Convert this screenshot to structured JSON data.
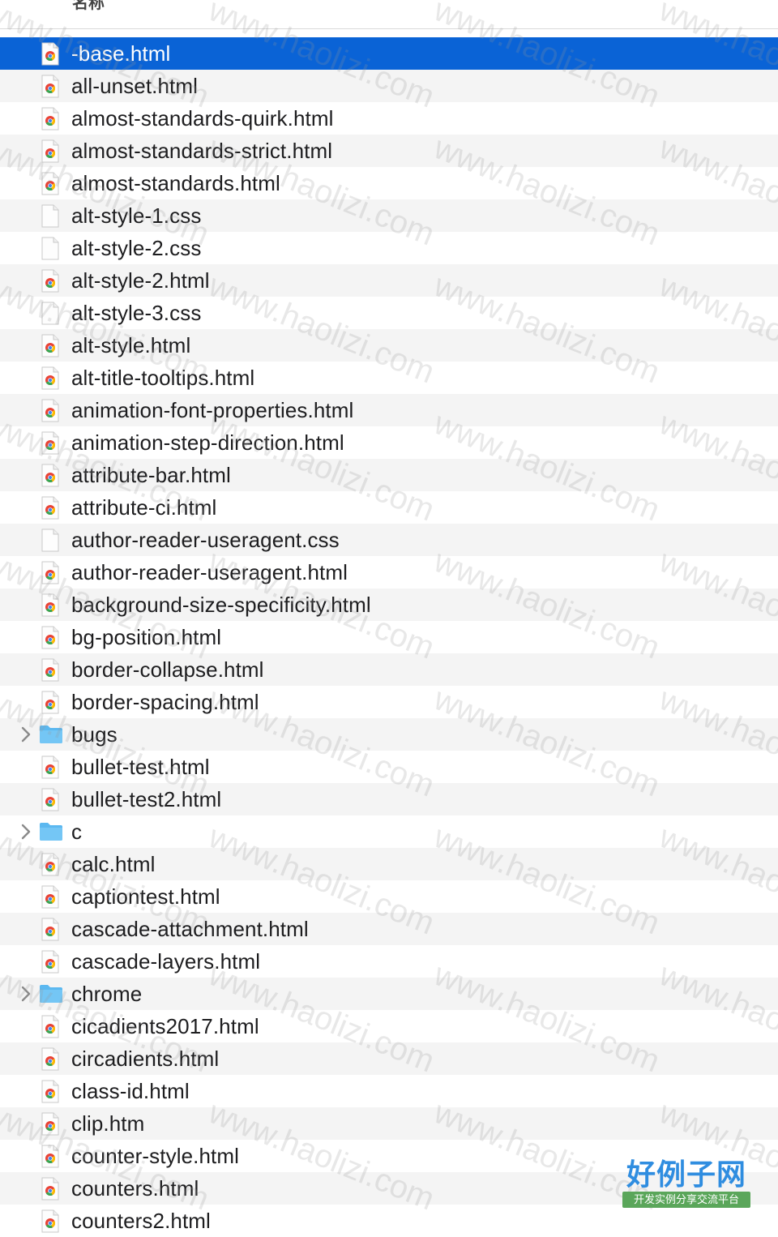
{
  "header": {
    "column_label": "名称"
  },
  "files": [
    {
      "name": "-base.html",
      "type": "html",
      "selected": true
    },
    {
      "name": "all-unset.html",
      "type": "html"
    },
    {
      "name": "almost-standards-quirk.html",
      "type": "html"
    },
    {
      "name": "almost-standards-strict.html",
      "type": "html"
    },
    {
      "name": "almost-standards.html",
      "type": "html"
    },
    {
      "name": "alt-style-1.css",
      "type": "css"
    },
    {
      "name": "alt-style-2.css",
      "type": "css"
    },
    {
      "name": "alt-style-2.html",
      "type": "html"
    },
    {
      "name": "alt-style-3.css",
      "type": "css"
    },
    {
      "name": "alt-style.html",
      "type": "html"
    },
    {
      "name": "alt-title-tooltips.html",
      "type": "html"
    },
    {
      "name": "animation-font-properties.html",
      "type": "html"
    },
    {
      "name": "animation-step-direction.html",
      "type": "html"
    },
    {
      "name": "attribute-bar.html",
      "type": "html"
    },
    {
      "name": "attribute-ci.html",
      "type": "html"
    },
    {
      "name": "author-reader-useragent.css",
      "type": "css"
    },
    {
      "name": "author-reader-useragent.html",
      "type": "html"
    },
    {
      "name": "background-size-specificity.html",
      "type": "html"
    },
    {
      "name": "bg-position.html",
      "type": "html"
    },
    {
      "name": "border-collapse.html",
      "type": "html"
    },
    {
      "name": "border-spacing.html",
      "type": "html"
    },
    {
      "name": "bugs",
      "type": "folder"
    },
    {
      "name": "bullet-test.html",
      "type": "html"
    },
    {
      "name": "bullet-test2.html",
      "type": "html"
    },
    {
      "name": "c",
      "type": "folder"
    },
    {
      "name": "calc.html",
      "type": "html"
    },
    {
      "name": "captiontest.html",
      "type": "html"
    },
    {
      "name": "cascade-attachment.html",
      "type": "html"
    },
    {
      "name": "cascade-layers.html",
      "type": "html"
    },
    {
      "name": "chrome",
      "type": "folder"
    },
    {
      "name": "cicadients2017.html",
      "type": "html"
    },
    {
      "name": "circadients.html",
      "type": "html"
    },
    {
      "name": "class-id.html",
      "type": "html"
    },
    {
      "name": "clip.htm",
      "type": "html"
    },
    {
      "name": "counter-style.html",
      "type": "html"
    },
    {
      "name": "counters.html",
      "type": "html"
    },
    {
      "name": "counters2.html",
      "type": "html"
    }
  ],
  "watermark": {
    "text": "www.haolizi.com"
  },
  "logo": {
    "title": "好例子网",
    "subtitle": "开发实例分享交流平台"
  },
  "colors": {
    "selection": "#0a63d6",
    "folder": "#5bb8f0",
    "zebra": "#f4f4f4"
  }
}
